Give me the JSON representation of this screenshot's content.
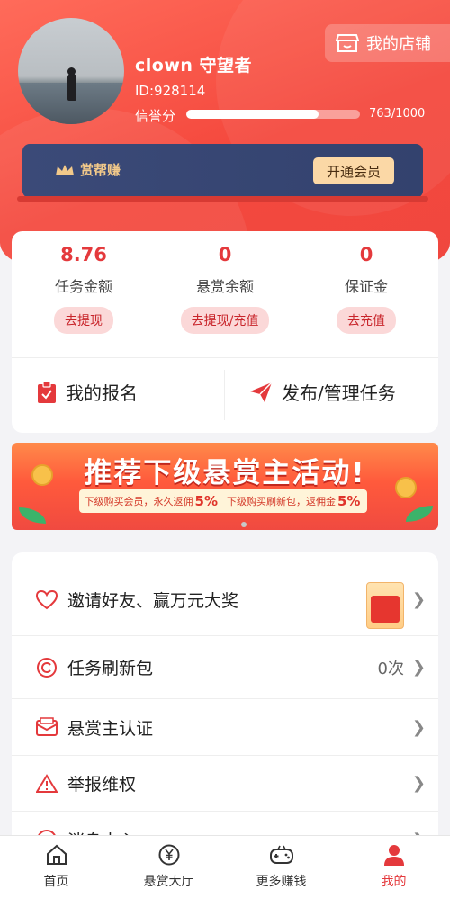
{
  "profile": {
    "name": "clown  守望者",
    "id": "ID:928114",
    "credit_label": "信誉分",
    "credit_value": "763/1000",
    "credit_ratio": 0.763
  },
  "shop": {
    "label": "我的店铺"
  },
  "vip": {
    "brand": "赏帮赚",
    "button": "开通会员"
  },
  "stats": [
    {
      "value": "8.76",
      "label": "任务金额",
      "action": "去提现"
    },
    {
      "value": "0",
      "label": "悬赏余额",
      "action": "去提现/充值"
    },
    {
      "value": "0",
      "label": "保证金",
      "action": "去充值"
    }
  ],
  "quick": {
    "signup": "我的报名",
    "publish": "发布/管理任务"
  },
  "banner": {
    "title": "推荐下级悬赏主活动!",
    "left_text": "下级购买会员，永久返佣",
    "left_pct": "5%",
    "right_text": "下级购买刷新包，返佣金",
    "right_pct": "5%"
  },
  "list": [
    {
      "label": "邀请好友、赢万元大奖",
      "value": "",
      "icon": "heart-icon"
    },
    {
      "label": "任务刷新包",
      "value": "0次",
      "icon": "refresh-icon"
    },
    {
      "label": "悬赏主认证",
      "value": "",
      "icon": "mail-icon"
    },
    {
      "label": "举报维权",
      "value": "",
      "icon": "warning-icon"
    },
    {
      "label": "消息中心",
      "value": "",
      "icon": "message-icon"
    }
  ],
  "tabs": [
    {
      "label": "首页",
      "icon": "home-icon"
    },
    {
      "label": "悬赏大厅",
      "icon": "yuan-icon"
    },
    {
      "label": "更多赚钱",
      "icon": "gamepad-icon"
    },
    {
      "label": "我的",
      "icon": "user-icon"
    }
  ],
  "colors": {
    "primary": "#f4483d",
    "vip_bg": "#3b4a78",
    "vip_gold": "#fbd8a6"
  }
}
